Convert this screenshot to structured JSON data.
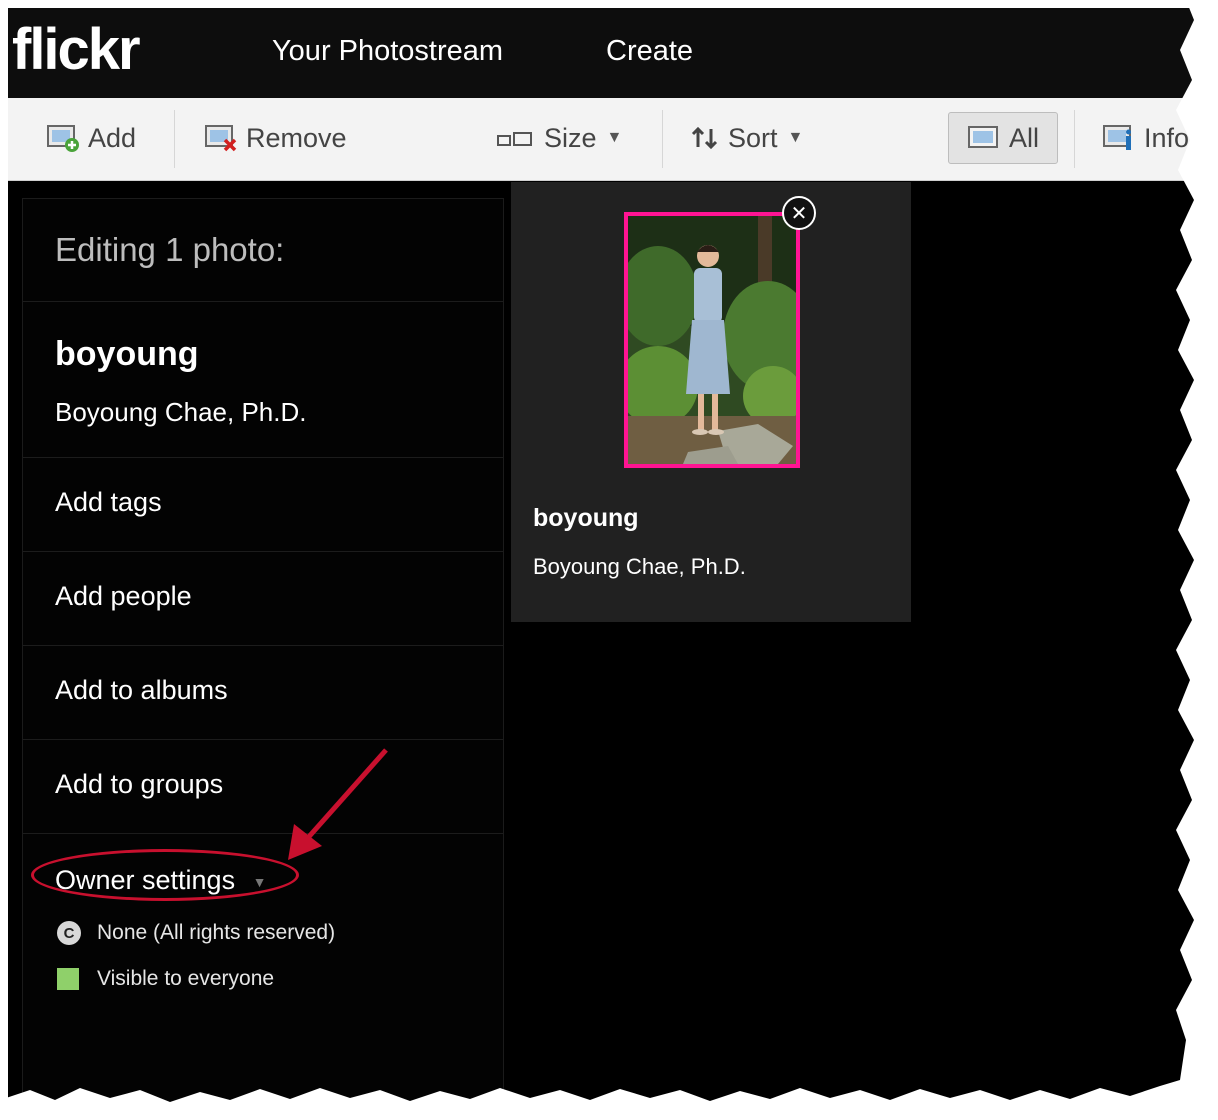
{
  "nav": {
    "logo": "flickr",
    "photostream": "Your Photostream",
    "create": "Create"
  },
  "toolbar": {
    "add": "Add",
    "remove": "Remove",
    "size": "Size",
    "sort": "Sort",
    "all": "All",
    "info": "Info"
  },
  "panel": {
    "heading": "Editing 1 photo:",
    "title": "boyoung",
    "description": "Boyoung Chae, Ph.D.",
    "actions": [
      "Add tags",
      "Add people",
      "Add to albums",
      "Add to groups"
    ],
    "owner_settings": "Owner settings",
    "license": "None (All rights reserved)",
    "visibility": "Visible to everyone"
  },
  "card": {
    "title": "boyoung",
    "description": "Boyoung Chae, Ph.D."
  },
  "colors": {
    "selection_border": "#ff1493",
    "annotation_red": "#c8102e",
    "visible_green": "#8fd06a"
  }
}
